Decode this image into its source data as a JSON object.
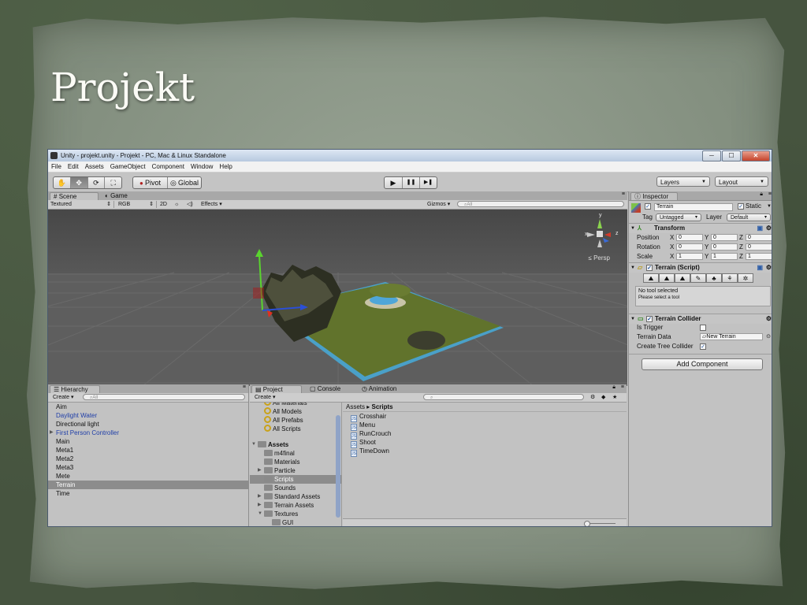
{
  "slide": {
    "title": "Projekt"
  },
  "window": {
    "title": "Unity - projekt.unity - Projekt - PC, Mac & Linux Standalone",
    "controls": {
      "minimize": "─",
      "maximize": "☐",
      "close": "✕"
    }
  },
  "menu": [
    "File",
    "Edit",
    "Assets",
    "GameObject",
    "Component",
    "Window",
    "Help"
  ],
  "toolbar": {
    "tools": [
      "✋",
      "✥",
      "⟳",
      "⛶"
    ],
    "pivot": "Pivot",
    "global": "Global",
    "play": "▶",
    "pause": "❚❚",
    "step": "▶❚",
    "layers": "Layers",
    "layout": "Layout"
  },
  "scene": {
    "tabs": [
      "Scene",
      "Game"
    ],
    "render_mode": "Textured",
    "color_mode": "RGB",
    "mode_2d": "2D",
    "effects": "Effects",
    "gizmos": "Gizmos",
    "search_placeholder": "All",
    "persp": "Persp",
    "gizmo_axis": {
      "x": "x",
      "y": "y",
      "z": "z"
    }
  },
  "hierarchy": {
    "tab": "Hierarchy",
    "create": "Create",
    "search_placeholder": "All",
    "items": [
      {
        "label": "Aim",
        "style": "normal"
      },
      {
        "label": "Daylight Water",
        "style": "blue"
      },
      {
        "label": "Directional light",
        "style": "normal"
      },
      {
        "label": "First Person Controller",
        "style": "blue",
        "expandable": true
      },
      {
        "label": "Main",
        "style": "normal"
      },
      {
        "label": "Meta1",
        "style": "normal"
      },
      {
        "label": "Meta2",
        "style": "normal"
      },
      {
        "label": "Meta3",
        "style": "normal"
      },
      {
        "label": "Mete",
        "style": "normal"
      },
      {
        "label": "Terrain",
        "style": "selected"
      },
      {
        "label": "Time",
        "style": "normal"
      }
    ]
  },
  "project": {
    "tabs": [
      "Project",
      "Console",
      "Animation"
    ],
    "create": "Create",
    "favorites": [
      "All Materials",
      "All Models",
      "All Prefabs",
      "All Scripts"
    ],
    "assets_root": "Assets",
    "folders": [
      {
        "label": "m4final",
        "expandable": false
      },
      {
        "label": "Materials",
        "expandable": false
      },
      {
        "label": "Particle",
        "expandable": true
      },
      {
        "label": "Scripts",
        "expandable": false,
        "selected": true
      },
      {
        "label": "Sounds",
        "expandable": false
      },
      {
        "label": "Standard Assets",
        "expandable": true
      },
      {
        "label": "Terrain Assets",
        "expandable": true
      },
      {
        "label": "Textures",
        "expandable": true,
        "open": true
      },
      {
        "label": "GUI",
        "expandable": false,
        "child": true
      }
    ],
    "breadcrumb": {
      "root": "Assets",
      "sep": "▸",
      "current": "Scripts"
    },
    "files": [
      "Crosshair",
      "Menu",
      "RunCrouch",
      "Shoot",
      "TimeDown"
    ]
  },
  "inspector": {
    "tab": "Inspector",
    "object_name": "Terrain",
    "static_label": "Static",
    "tag_label": "Tag",
    "tag_value": "Untagged",
    "layer_label": "Layer",
    "layer_value": "Default",
    "transform": {
      "title": "Transform",
      "rows": [
        {
          "label": "Position",
          "x": "0",
          "y": "0",
          "z": "0"
        },
        {
          "label": "Rotation",
          "x": "0",
          "y": "0",
          "z": "0"
        },
        {
          "label": "Scale",
          "x": "1",
          "y": "1",
          "z": "1"
        }
      ],
      "axis": {
        "x": "X",
        "y": "Y",
        "z": "Z"
      }
    },
    "terrain_script": {
      "title": "Terrain (Script)",
      "tools": [
        "⛰",
        "⛰",
        "⛰",
        "✎",
        "♣",
        "⚘",
        "✲"
      ],
      "msg1": "No tool selected",
      "msg2": "Please select a tool"
    },
    "terrain_collider": {
      "title": "Terrain Collider",
      "is_trigger": "Is Trigger",
      "terrain_data": "Terrain Data",
      "terrain_data_value": "New Terrain",
      "create_tree_collider": "Create Tree Collider"
    },
    "add_component": "Add Component"
  }
}
